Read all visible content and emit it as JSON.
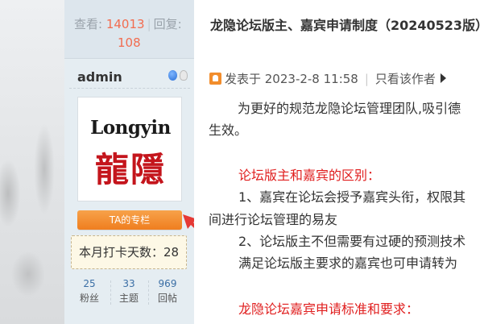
{
  "author_panel": {
    "views_label": "查看:",
    "views_count": "14013",
    "replies_label": "回复:",
    "replies_count": "108",
    "username": "admin",
    "avatar": {
      "logo_en": "Longyin",
      "logo_cn": "龍隱"
    },
    "ta_column_button": "TA的专栏",
    "checkin_text": "本月打卡天数：28",
    "mini_stats": [
      {
        "value": "25",
        "label": "粉丝"
      },
      {
        "value": "33",
        "label": "主题"
      },
      {
        "value": "969",
        "label": "回帖"
      }
    ]
  },
  "post": {
    "thread_title": "龙隐论坛版主、嘉宾申请制度（20240523版）",
    "posted_label": "发表于 2023-2-8 11:58",
    "only_author_label": "只看该作者",
    "paragraphs": [
      {
        "text": "为更好的规范龙隐论坛管理团队,吸引德",
        "style": "normal"
      },
      {
        "text": "生效。",
        "style": "normal"
      },
      {
        "text": "论坛版主和嘉宾的区别：",
        "style": "red"
      },
      {
        "text": "1、嘉宾在论坛会授予嘉宾头衔，权限其",
        "style": "normal"
      },
      {
        "text": "间进行论坛管理的易友",
        "style": "normal"
      },
      {
        "text": "2、论坛版主不但需要有过硬的预测技术",
        "style": "normal"
      },
      {
        "text": "满足论坛版主要求的嘉宾也可申请转为",
        "style": "normal"
      },
      {
        "text": "龙隐论坛嘉宾申请标准和要求：",
        "style": "red"
      }
    ]
  },
  "colors": {
    "accent_orange": "#ef7e1f",
    "count_red": "#f26c4f",
    "link_blue": "#3a6ea5",
    "section_red": "#e01e1e",
    "logo_red": "#c4151c"
  },
  "icons": [
    "qq-status-icon",
    "online-bulb-icon",
    "post-pin-icon",
    "triangle-right-icon",
    "red-arrow-icon"
  ]
}
